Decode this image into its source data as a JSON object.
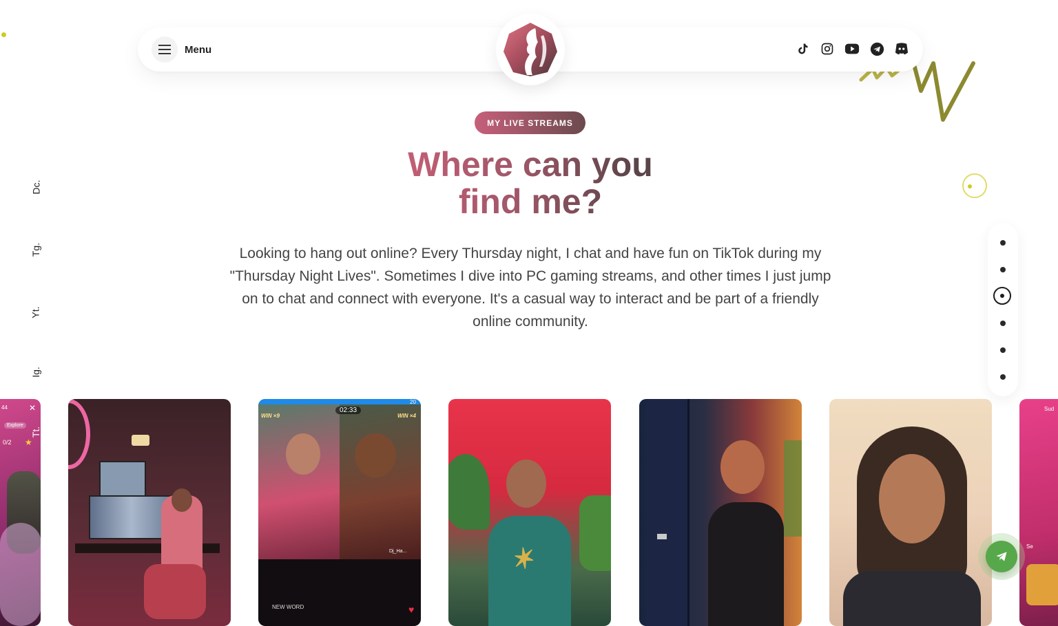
{
  "header": {
    "menu_label": "Menu",
    "socials": [
      {
        "name": "tiktok-icon"
      },
      {
        "name": "instagram-icon"
      },
      {
        "name": "youtube-icon"
      },
      {
        "name": "telegram-icon"
      },
      {
        "name": "discord-icon"
      }
    ]
  },
  "section": {
    "badge": "MY LIVE STREAMS",
    "heading_line1": "Where can you",
    "heading_line2": "find me?",
    "description": "Looking to hang out online? Every Thursday night, I chat and have fun on TikTok during my \"Thursday Night Lives\". Sometimes I dive into PC gaming streams, and other times I just jump on to chat and connect with everyone. It's a casual way to interact and be part of a friendly online community."
  },
  "side_links": [
    {
      "label": "Dc."
    },
    {
      "label": "Tg."
    },
    {
      "label": "Yt."
    },
    {
      "label": "Ig."
    },
    {
      "label": "Tt."
    }
  ],
  "cards": [
    {
      "texts": [
        "44",
        "Explore",
        "0/2"
      ]
    },
    {
      "texts": []
    },
    {
      "texts": [
        "WIN ×9",
        "02:33",
        "WIN ×4",
        "20",
        "Dj_Ha...",
        "NEW WORD"
      ]
    },
    {
      "texts": []
    },
    {
      "texts": []
    },
    {
      "texts": []
    },
    {
      "texts": [
        "Sud",
        "Se"
      ]
    }
  ],
  "colors": {
    "accent_pink": "#c7607a",
    "accent_dark": "#5a4548",
    "olive": "#8c8a30",
    "fab_green": "#57a84a"
  }
}
